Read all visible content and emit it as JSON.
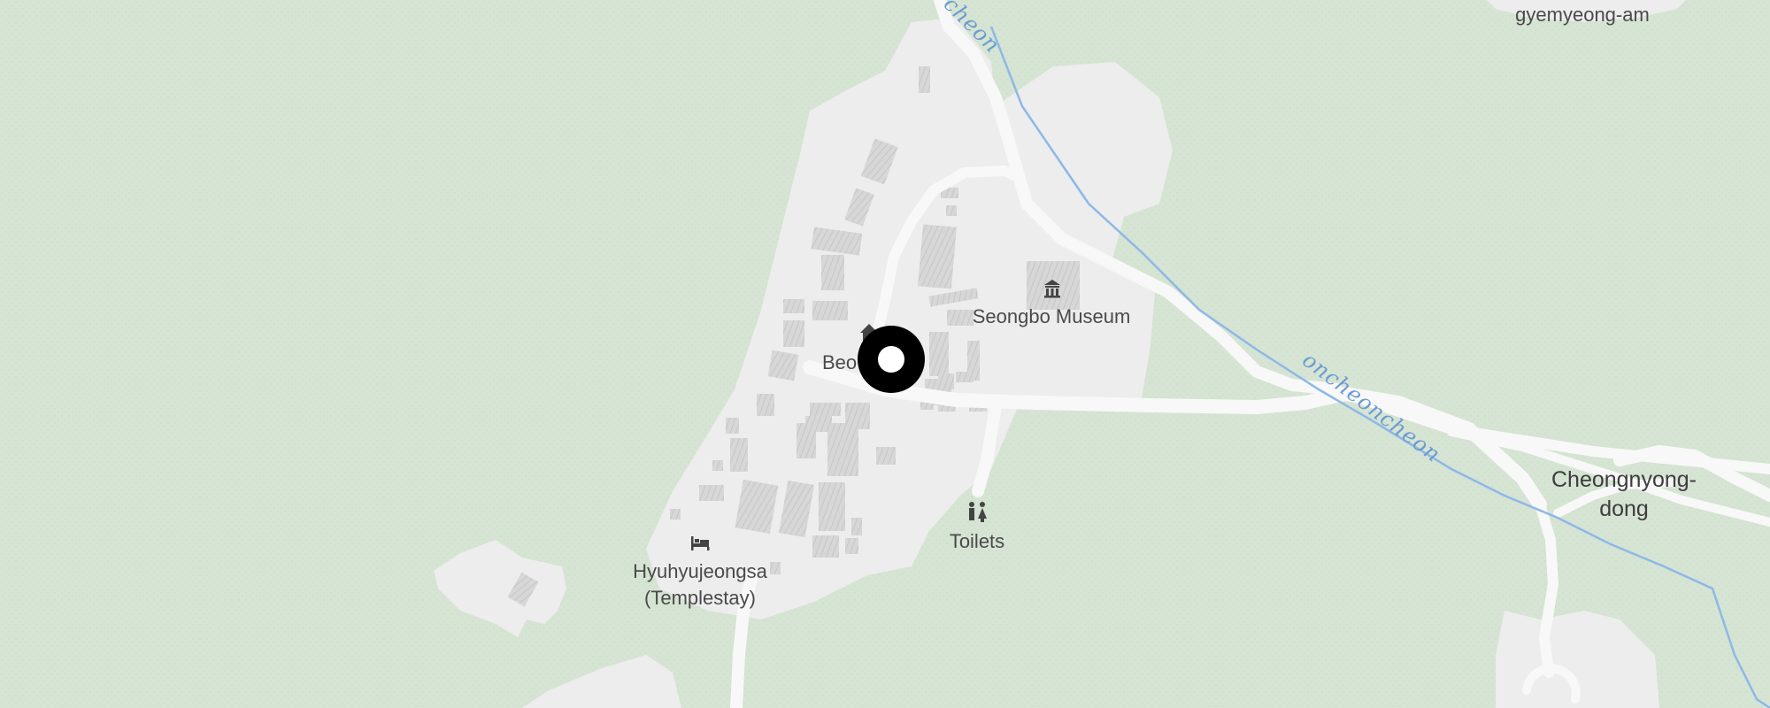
{
  "map": {
    "background_color": "#d6e4d3",
    "land_color": "#ededed",
    "road_color": "#f7f7f7",
    "building_color": "#d8d8d8",
    "water_color": "#8db8e8"
  },
  "labels": {
    "river_top": "cheon",
    "river_middle": "oncheoncheon",
    "gyemyeong_am": "gyemyeong-am",
    "seongbo_museum": "Seongbo Museum",
    "beo_partial": "Beo",
    "toilets": "Toilets",
    "hyuhyujeongsa_line1": "Hyuhyujeongsa",
    "hyuhyujeongsa_line2": "(Templestay)",
    "cheongnyong_line1": "Cheongnyong-",
    "cheongnyong_line2": "dong"
  },
  "icons": {
    "museum": "museum-icon",
    "toilets": "toilets-icon",
    "lodging": "bed-icon",
    "temple": "temple-icon",
    "location": "location-marker-icon"
  }
}
